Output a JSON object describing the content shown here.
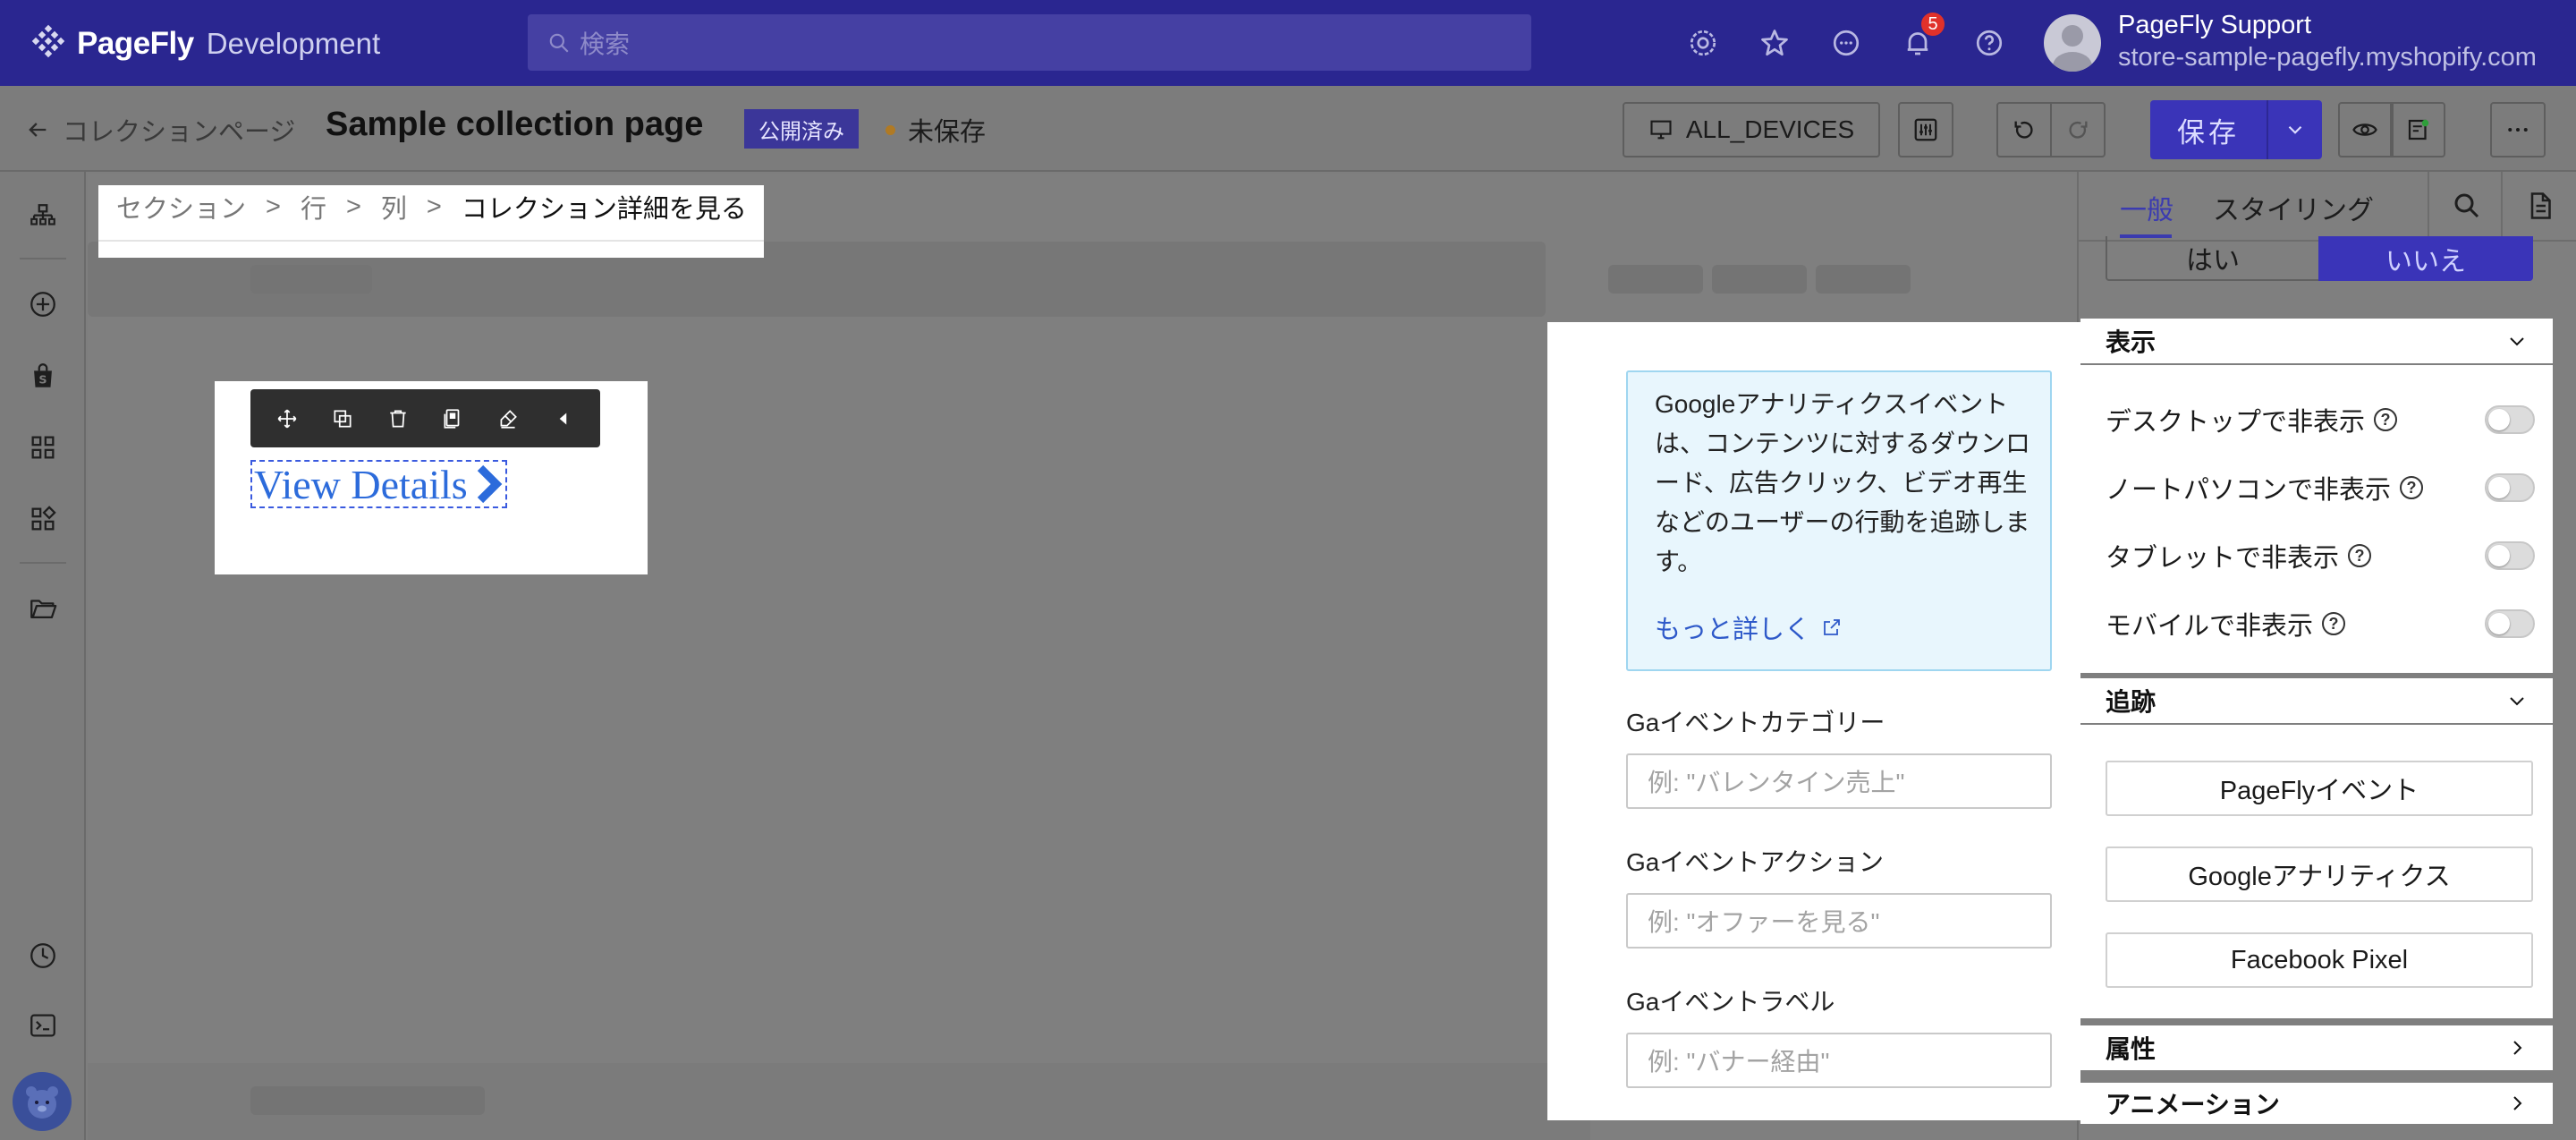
{
  "app": {
    "brand": "PageFly",
    "env": "Development",
    "search_placeholder": "検索",
    "notification_count": "5",
    "user": {
      "name": "PageFly Support",
      "store": "store-sample-pagefly.myshopify.com"
    }
  },
  "editor_bar": {
    "back_label": "コレクションページ",
    "page_title": "Sample collection page",
    "status_badge": "公開済み",
    "save_state": "未保存",
    "device_label": "ALL_DEVICES",
    "save_label": "保存"
  },
  "breadcrumb": [
    "セクション",
    "行",
    "列",
    "コレクション詳細を見る"
  ],
  "breadcrumb_sep": ">",
  "element": {
    "link_text": "View Details"
  },
  "popup": {
    "info_text": "Googleアナリティクスイベントは、コンテンツに対するダウンロード、広告クリック、ビデオ再生などのユーザーの行動を追跡します。",
    "learn_more": "もっと詳しく",
    "fields": [
      {
        "label": "Gaイベントカテゴリー",
        "placeholder": "例: \"バレンタイン売上\""
      },
      {
        "label": "Gaイベントアクション",
        "placeholder": "例: \"オファーを見る\""
      },
      {
        "label": "Gaイベントラベル",
        "placeholder": "例: \"バナー経由\""
      }
    ]
  },
  "right_panel": {
    "tabs": [
      "一般",
      "スタイリング"
    ],
    "yes_label": "はい",
    "no_label": "いいえ",
    "display_section": "表示",
    "toggles": [
      "デスクトップで非表示",
      "ノートパソコンで非表示",
      "タブレットで非表示",
      "モバイルで非表示"
    ],
    "tracking_section": "追跡",
    "tracking_buttons": [
      "PageFlyイベント",
      "Googleアナリティクス",
      "Facebook Pixel"
    ],
    "attributes_section": "属性",
    "animation_section": "アニメーション"
  },
  "colors": {
    "topbar": "#2a2690",
    "accent": "#3a34b8",
    "link": "#2c6bdb",
    "info_bg": "#e8f6fd"
  }
}
